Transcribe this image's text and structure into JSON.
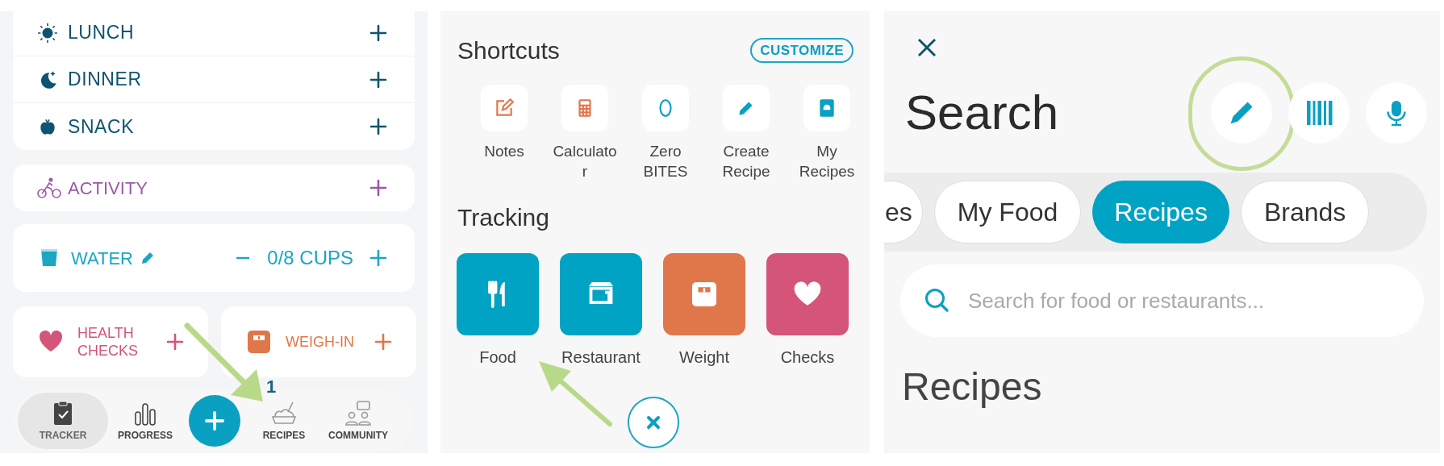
{
  "tracker": {
    "meals": [
      {
        "kind": "lunch",
        "label": "LUNCH"
      },
      {
        "kind": "dinner",
        "label": "DINNER"
      },
      {
        "kind": "snack",
        "label": "SNACK"
      }
    ],
    "activity": {
      "label": "ACTIVITY"
    },
    "water": {
      "label": "WATER",
      "reading": "0/8 CUPS"
    },
    "cards": [
      {
        "kind": "health",
        "label": "HEALTH CHECKS"
      },
      {
        "kind": "weigh",
        "label": "WEIGH-IN"
      }
    ],
    "nav": [
      {
        "kind": "tracker",
        "label": "TRACKER",
        "selected": true
      },
      {
        "kind": "progress",
        "label": "PROGRESS",
        "selected": false
      },
      {
        "kind": "add",
        "selected": false
      },
      {
        "kind": "recipes",
        "label": "RECIPES",
        "selected": false
      },
      {
        "kind": "community",
        "label": "COMMUNITY",
        "selected": false
      }
    ],
    "annotation": {
      "label": "1"
    }
  },
  "shortcuts_panel": {
    "title": "Shortcuts",
    "customize": "CUSTOMIZE",
    "shortcuts": [
      {
        "kind": "notes",
        "label": "Notes"
      },
      {
        "kind": "calculator",
        "label": "Calculator"
      },
      {
        "kind": "zero",
        "label": "Zero BITES"
      },
      {
        "kind": "create",
        "label": "Create Recipe"
      },
      {
        "kind": "myrecipes",
        "label": "My Recipes"
      }
    ],
    "tracking_title": "Tracking",
    "tracking": [
      {
        "kind": "food",
        "label": "Food",
        "color": "#00a3c4"
      },
      {
        "kind": "restaurant",
        "label": "Restaurant",
        "color": "#00a3c4"
      },
      {
        "kind": "weight",
        "label": "Weight",
        "color": "#e0774b"
      },
      {
        "kind": "checks",
        "label": "Checks",
        "color": "#d4547a"
      }
    ]
  },
  "search_panel": {
    "title": "Search",
    "tools": [
      {
        "kind": "pencil",
        "circled": true
      },
      {
        "kind": "barcode",
        "circled": false
      },
      {
        "kind": "mic",
        "circled": false
      }
    ],
    "tabs": [
      {
        "label": "es",
        "selected": false
      },
      {
        "label": "My Food",
        "selected": false
      },
      {
        "label": "Recipes",
        "selected": true
      },
      {
        "label": "Brands",
        "selected": false
      }
    ],
    "search": {
      "placeholder": "Search for food or restaurants..."
    },
    "heading": "Recipes"
  }
}
